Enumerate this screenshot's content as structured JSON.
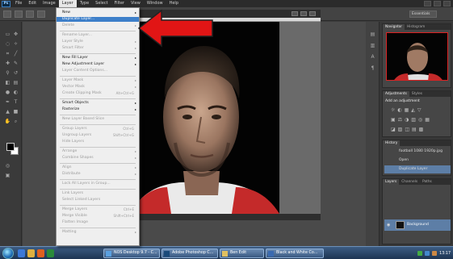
{
  "menubar": {
    "app_icon": "Ps",
    "items": [
      "File",
      "Edit",
      "Image",
      "Layer",
      "Type",
      "Select",
      "Filter",
      "View",
      "Window",
      "Help"
    ],
    "active": "Layer"
  },
  "options_bar": {
    "workspace": "Essentials"
  },
  "layer_menu": {
    "items": [
      {
        "label": "New",
        "submenu": true,
        "disabled": false
      },
      {
        "label": "Duplicate Layer...",
        "disabled": false,
        "highlight": true
      },
      {
        "label": "Delete",
        "submenu": true,
        "disabled": true
      },
      {
        "label": "Rename Layer...",
        "disabled": true,
        "sep_before": true
      },
      {
        "label": "Layer Style",
        "submenu": true,
        "disabled": true
      },
      {
        "label": "Smart Filter",
        "submenu": true,
        "disabled": true
      },
      {
        "label": "New Fill Layer",
        "submenu": true,
        "disabled": false,
        "sep_before": true
      },
      {
        "label": "New Adjustment Layer",
        "submenu": true,
        "disabled": false
      },
      {
        "label": "Layer Content Options...",
        "disabled": true
      },
      {
        "label": "Layer Mask",
        "submenu": true,
        "disabled": true,
        "sep_before": true
      },
      {
        "label": "Vector Mask",
        "submenu": true,
        "disabled": true
      },
      {
        "label": "Create Clipping Mask",
        "shortcut": "Alt+Ctrl+G",
        "disabled": true
      },
      {
        "label": "Smart Objects",
        "submenu": true,
        "disabled": false,
        "sep_before": true
      },
      {
        "label": "Rasterize",
        "submenu": true,
        "disabled": false
      },
      {
        "label": "New Layer Based Slice",
        "disabled": true,
        "sep_before": true
      },
      {
        "label": "Group Layers",
        "shortcut": "Ctrl+G",
        "disabled": true,
        "sep_before": true
      },
      {
        "label": "Ungroup Layers",
        "shortcut": "Shift+Ctrl+G",
        "disabled": true
      },
      {
        "label": "Hide Layers",
        "disabled": true
      },
      {
        "label": "Arrange",
        "submenu": true,
        "disabled": true,
        "sep_before": true
      },
      {
        "label": "Combine Shapes",
        "submenu": true,
        "disabled": true
      },
      {
        "label": "Align",
        "submenu": true,
        "disabled": true,
        "sep_before": true
      },
      {
        "label": "Distribute",
        "submenu": true,
        "disabled": true
      },
      {
        "label": "Lock All Layers in Group...",
        "disabled": true,
        "sep_before": true
      },
      {
        "label": "Link Layers",
        "disabled": true,
        "sep_before": true
      },
      {
        "label": "Select Linked Layers",
        "disabled": true
      },
      {
        "label": "Merge Layers",
        "shortcut": "Ctrl+E",
        "disabled": true,
        "sep_before": true
      },
      {
        "label": "Merge Visible",
        "shortcut": "Shift+Ctrl+E",
        "disabled": true
      },
      {
        "label": "Flatten Image",
        "disabled": true
      },
      {
        "label": "Matting",
        "submenu": true,
        "disabled": true,
        "sep_before": true
      }
    ]
  },
  "panels": {
    "navigator_tabs": [
      "Navigator",
      "Histogram"
    ],
    "adjustments_tabs": [
      "Adjustments",
      "Styles"
    ],
    "adjustments_title": "Add an adjustment",
    "history_tab": "History",
    "history_items": [
      "football 1080 1920p.jpg",
      "Open",
      "Duplicate Layer"
    ],
    "layers_tabs": [
      "Layers",
      "Channels",
      "Paths"
    ],
    "layer_name": "Background"
  },
  "taskbar": {
    "buttons": [
      "NOS Desktop 9.7 - C...",
      "Adobe Photoshop C...",
      "Ben Edit",
      "Black and White Co..."
    ],
    "clock": "13:17"
  },
  "colors": {
    "arrow": "#e11515",
    "highlight": "#3d7fc9",
    "menu_bg": "#efefef"
  }
}
